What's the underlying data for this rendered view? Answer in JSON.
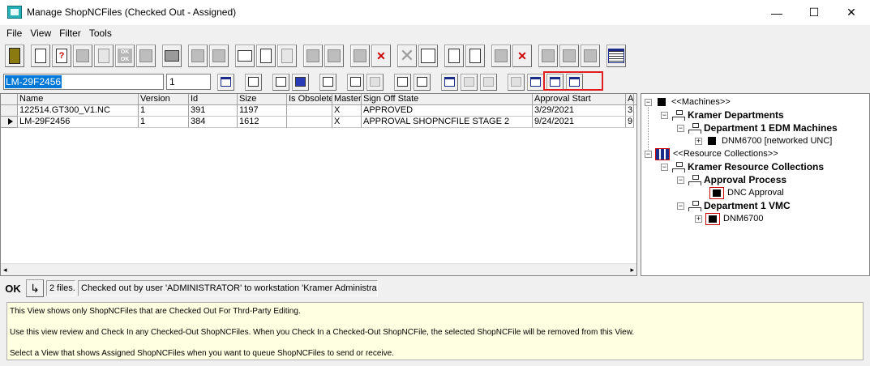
{
  "window": {
    "title": "Manage ShopNCFiles (Checked Out - Assigned)",
    "minimize": "—",
    "maximize": "☐",
    "close": "✕"
  },
  "menu": [
    "File",
    "View",
    "Filter",
    "Tools"
  ],
  "toolbar2": {
    "path_value": "LM-29F2456",
    "version_value": "1"
  },
  "grid": {
    "columns": [
      "Name",
      "Version",
      "Id",
      "Size",
      "Is Obsolete",
      "Master",
      "Sign Off State",
      "Approval Start",
      "A"
    ],
    "rows": [
      {
        "name": "122514.GT300_V1.NC",
        "version": "1",
        "id": "391",
        "size": "1197",
        "obsolete": "",
        "master": "X",
        "sign_off": "APPROVED",
        "approval_start": "3/29/2021",
        "a": "3",
        "current": false
      },
      {
        "name": "LM-29F2456",
        "version": "1",
        "id": "384",
        "size": "1612",
        "obsolete": "",
        "master": "X",
        "sign_off": "APPROVAL SHOPNCFILE STAGE 2",
        "approval_start": "9/24/2021",
        "a": "9",
        "current": true
      }
    ],
    "scroll_left": "◂",
    "scroll_right": "▸"
  },
  "tree": {
    "machines": "<<Machines>>",
    "kramer_departments": "Kramer Departments",
    "dept1_edm": "Department 1 EDM Machines",
    "dnm6700_unc": "DNM6700 [networked UNC]",
    "resource_collections": "<<Resource Collections>>",
    "kramer_resource_collections": "Kramer Resource Collections",
    "approval_process": "Approval Process",
    "dnc_approval": "DNC Approval",
    "dept1_vmc": "Department 1 VMC",
    "dnm6700": "DNM6700",
    "expand_minus": "−",
    "expand_plus": "+"
  },
  "status": {
    "ok_label": "OK",
    "arrow": "↳",
    "files": "2 files.",
    "message": "Checked out by user 'ADMINISTRATOR' to workstation 'Kramer Administrator"
  },
  "info": {
    "line1": "This View shows only ShopNCFiles that are Checked Out For Thrd-Party Editing.",
    "line2": "Use this view review and Check In any Checked-Out ShopNCFiles. When you Check In a Checked-Out ShopNCFile, the selected ShopNCFile will be removed from this View.",
    "line3": "Select a View that shows Assigned ShopNCFiles when you want to queue ShopNCFiles to send or receive."
  },
  "colors": {
    "highlight_border": "#e02020",
    "info_background": "#ffffe1",
    "selection_blue": "#0078d7"
  }
}
